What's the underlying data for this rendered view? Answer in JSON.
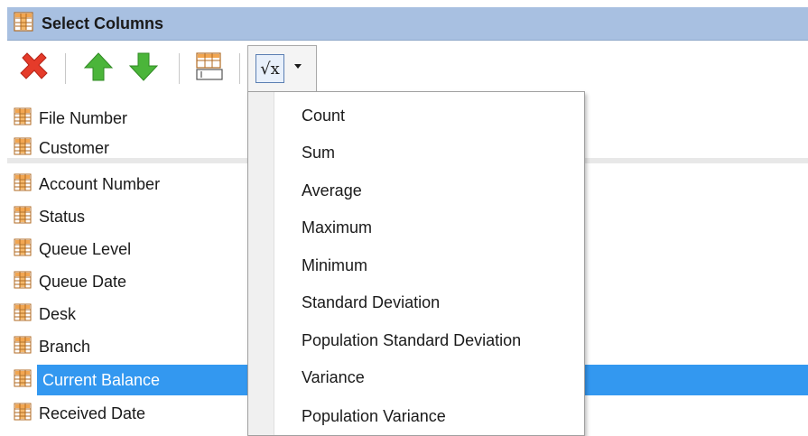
{
  "window": {
    "title": "Select Columns"
  },
  "toolbar": {
    "delete_icon": "delete-x-icon",
    "up_icon": "arrow-up-icon",
    "down_icon": "arrow-down-icon",
    "columns_icon": "column-select-icon",
    "function_icon": "square-root-icon",
    "function_symbol": "√x"
  },
  "columns": [
    {
      "label": "File Number"
    },
    {
      "label": "Customer"
    },
    {
      "label": "Account Number"
    },
    {
      "label": "Status"
    },
    {
      "label": "Queue Level"
    },
    {
      "label": "Queue Date"
    },
    {
      "label": "Desk"
    },
    {
      "label": "Branch"
    },
    {
      "label": "Current Balance",
      "selected": true
    },
    {
      "label": "Received Date"
    }
  ],
  "menu": {
    "items": [
      {
        "label": "Count"
      },
      {
        "label": "Sum"
      },
      {
        "label": "Average"
      },
      {
        "label": "Maximum"
      },
      {
        "label": "Minimum"
      },
      {
        "label": "Standard Deviation"
      },
      {
        "label": "Population Standard Deviation"
      },
      {
        "label": "Variance"
      },
      {
        "label": "Population Variance"
      }
    ]
  },
  "colors": {
    "title_bg": "#a8c0e1",
    "selection": "#3398f0",
    "delete_red": "#e53b2a",
    "arrow_green": "#4bb53a",
    "column_icon": "#e8923a"
  }
}
